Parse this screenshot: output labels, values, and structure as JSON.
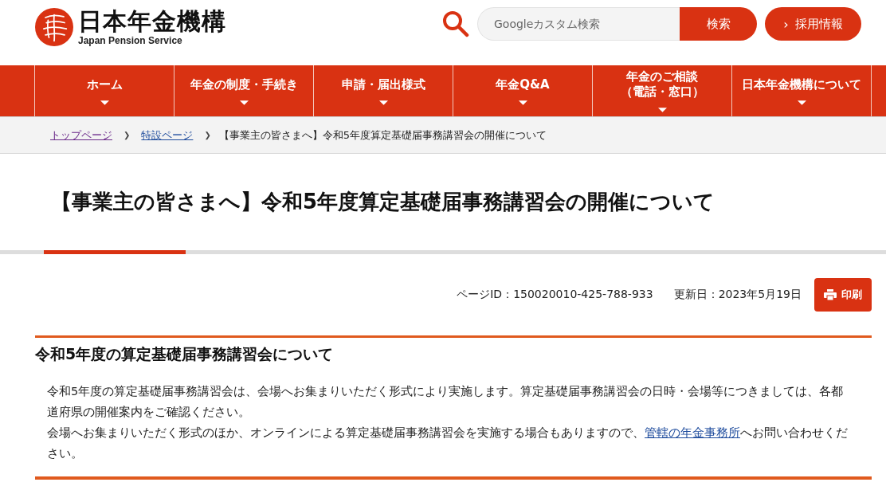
{
  "header": {
    "logo_text": "日本年金機構",
    "logo_subtitle": "Japan Pension Service",
    "search": {
      "placeholder": "Googleカスタム検索",
      "button": "検索"
    },
    "recruit_button": {
      "arrow": "›",
      "label": "採用情報"
    }
  },
  "nav": [
    {
      "lines": [
        "ホーム"
      ]
    },
    {
      "lines": [
        "年金の制度・手続き"
      ]
    },
    {
      "lines": [
        "申請・届出様式"
      ]
    },
    {
      "lines": [
        "年金Q&A"
      ]
    },
    {
      "lines": [
        "年金のご相談",
        "（電話・窓口）"
      ]
    },
    {
      "lines": [
        "日本年金機構について"
      ]
    }
  ],
  "breadcrumb": {
    "separator": "❯",
    "items": [
      {
        "label": "トップページ",
        "kind": "link"
      },
      {
        "label": "特設ページ",
        "kind": "link"
      },
      {
        "label": "【事業主の皆さまへ】令和5年度算定基礎届事務講習会の開催について",
        "kind": "current"
      }
    ]
  },
  "page_title": "【事業主の皆さまへ】令和5年度算定基礎届事務講習会の開催について",
  "meta": {
    "page_id": "ページID：150020010-425-788-933",
    "updated": "更新日：2023年5月19日",
    "print_button": "印刷"
  },
  "section": {
    "heading": "令和5年度の算定基礎届事務講習会について",
    "paragraphs": [
      {
        "before": "令和5年度の算定基礎届事務講習会は、会場へお集まりいただく形式により実施します。算定基礎届事務講習会の日時・会場等につきましては、各都道府県の開催案内をご確認ください。"
      },
      {
        "before": "会場へお集まりいただく形式のほか、オンラインによる算定基礎届事務講習会を実施する場合もありますので、",
        "link": "管轄の年金事務所",
        "after": "へお問い合わせください。"
      }
    ]
  }
}
